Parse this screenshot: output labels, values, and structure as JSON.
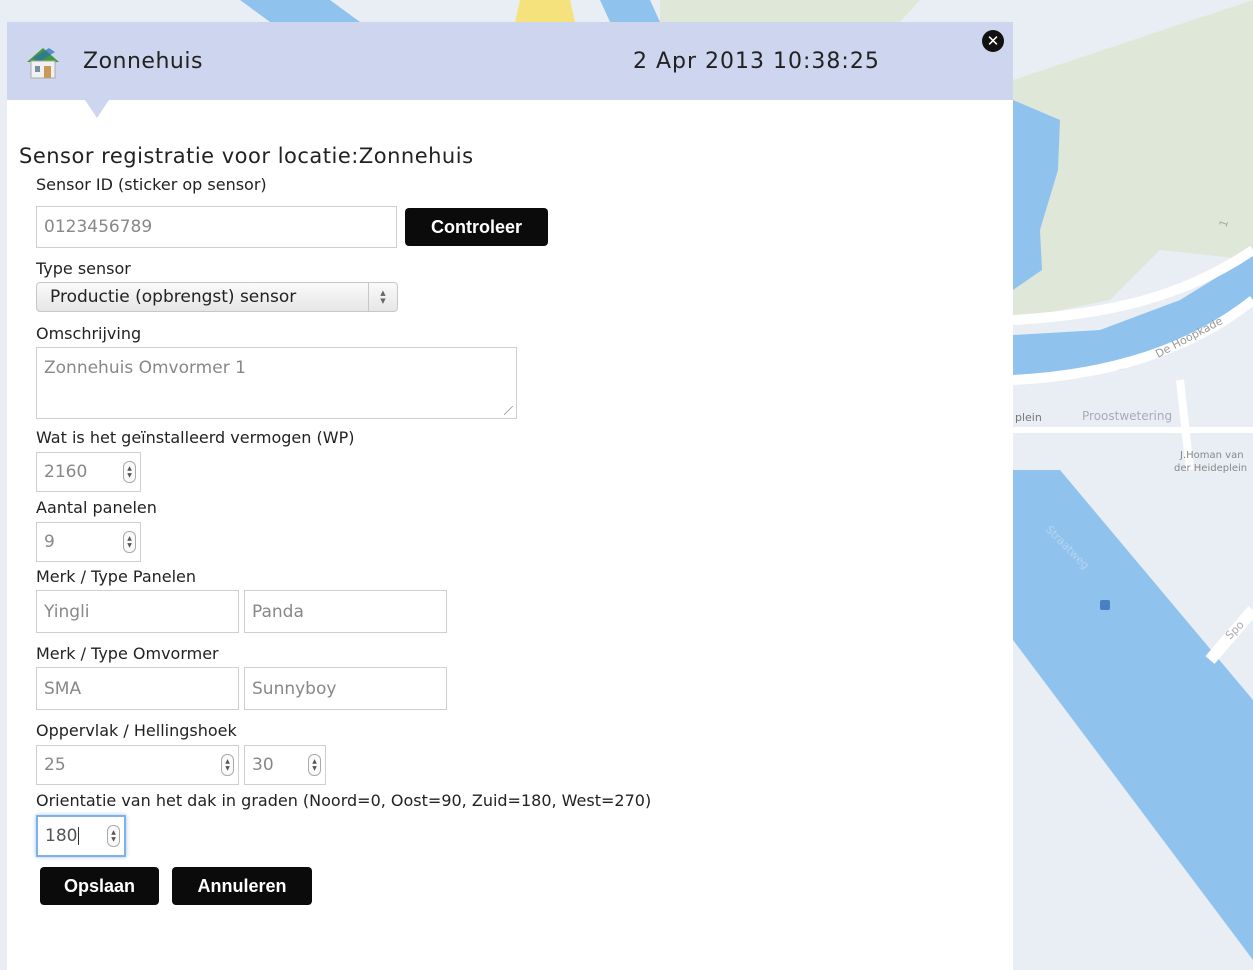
{
  "header": {
    "title": "Zonnehuis",
    "datetime": "2 Apr 2013 10:38:25",
    "close_icon": "close-icon",
    "house_icon": "house-icon"
  },
  "form": {
    "title": "Sensor registratie voor locatie:Zonnehuis",
    "sensor_id": {
      "label": "Sensor ID (sticker op sensor)",
      "value": "0123456789"
    },
    "check_button": "Controleer",
    "sensor_type": {
      "label": "Type sensor",
      "selected": "Productie (opbrengst) sensor"
    },
    "description": {
      "label": "Omschrijving",
      "value": "Zonnehuis Omvormer 1"
    },
    "power": {
      "label": "Wat is het geïnstalleerd vermogen (WP)",
      "value": "2160"
    },
    "panel_count": {
      "label": "Aantal panelen",
      "value": "9"
    },
    "panel_brand": {
      "label": "Merk / Type Panelen",
      "brand": "Yingli",
      "type": "Panda"
    },
    "inverter_brand": {
      "label": "Merk / Type Omvormer",
      "brand": "SMA",
      "type": "Sunnyboy"
    },
    "area_tilt": {
      "label": "Oppervlak / Hellingshoek",
      "area": "25",
      "tilt": "30"
    },
    "orientation": {
      "label": "Orientatie van het dak in graden (Noord=0, Oost=90, Zuid=180, West=270)",
      "value": "180"
    },
    "save_button": "Opslaan",
    "cancel_button": "Annuleren"
  },
  "map": {
    "labels": {
      "hoopkade": "De Hoopkade",
      "plein": "plein",
      "proostwetering": "Proostwetering",
      "homan_line1": "J.Homan van",
      "homan_line2": "der Heideplein",
      "straatweg": "Straatweg",
      "spo": "Spo",
      "one": "1"
    },
    "colors": {
      "land": "#e9eef5",
      "water": "#8fc3ee",
      "park": "#dfe8d8",
      "road": "#ffffff"
    }
  }
}
